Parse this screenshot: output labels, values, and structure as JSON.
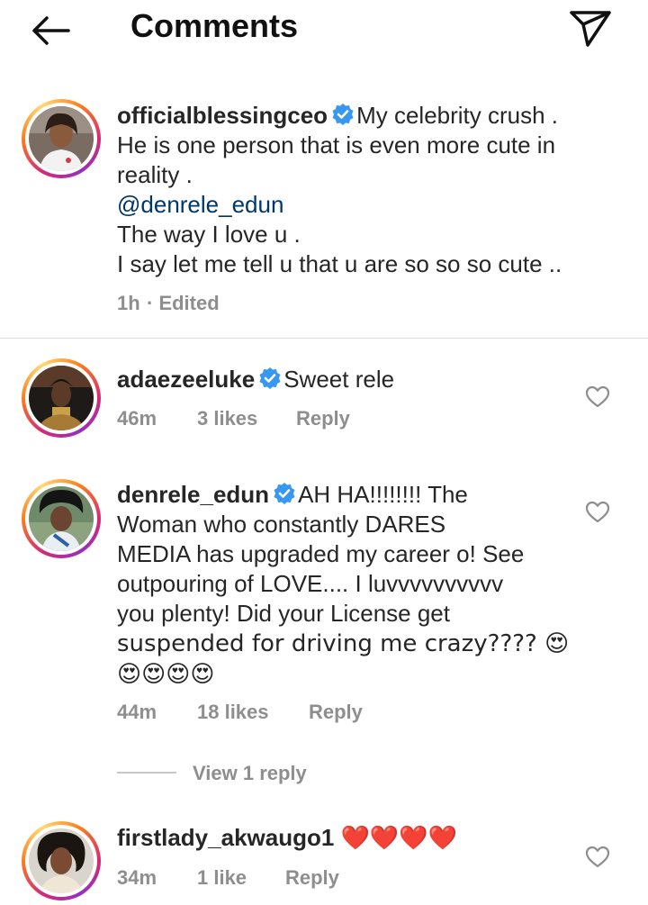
{
  "header": {
    "title": "Comments"
  },
  "comments": [
    {
      "username": "officialblessingceo",
      "lines": [
        "My celebrity crush .",
        "He is one person that is even more cute in",
        "reality ."
      ],
      "mention": "@denrele_edun",
      "lines_after": [
        "The way I love u .",
        "I say let me tell u that u are so so so cute .."
      ],
      "time": "1h",
      "edited": "· Edited"
    },
    {
      "username": "adaezeeluke",
      "text": "Sweet rele",
      "time": "46m",
      "likes": "3 likes",
      "reply": "Reply"
    },
    {
      "username": "denrele_edun",
      "lines": [
        "AH HA!!!!!!!! The",
        "Woman who constantly DARES",
        "MEDIA has upgraded my career o! See",
        "outpouring of LOVE.... I luvvvvvvvvvv",
        "you plenty! Did your License get",
        "suspended for driving me crazy???? 😍",
        "😍😍😍😍"
      ],
      "time": "44m",
      "likes": "18 likes",
      "reply": "Reply",
      "view_replies": "View 1 reply"
    },
    {
      "username": "firstlady_akwaugo1",
      "text": "❤️❤️❤️❤️",
      "time": "34m",
      "likes": "1 like",
      "reply": "Reply"
    }
  ],
  "colors": {
    "verified": "#3897f0",
    "mention": "#00376b",
    "meta": "#8e8e8e",
    "heart": "#e0142f"
  }
}
